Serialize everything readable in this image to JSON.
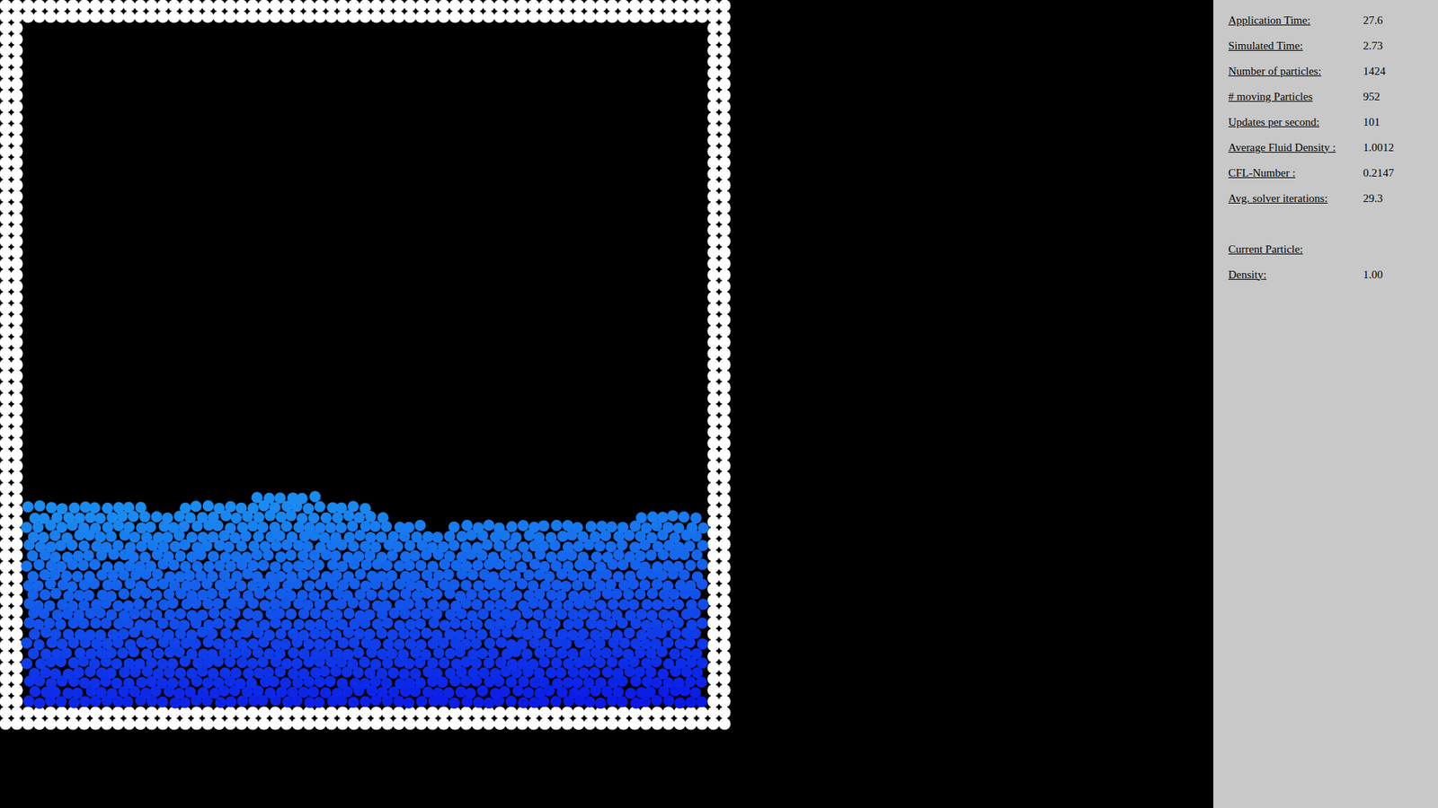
{
  "stats": [
    {
      "label": "Application Time:",
      "value": "27.6"
    },
    {
      "label": "Simulated Time:",
      "value": "2.73"
    },
    {
      "label": "Number of particles:",
      "value": "1424"
    },
    {
      "label": "# moving Particles",
      "value": "952"
    },
    {
      "label": "Updates per second:",
      "value": "101"
    },
    {
      "label": "Average Fluid Density :",
      "value": "1.0012"
    },
    {
      "label": "CFL-Number :",
      "value": "0.2147"
    },
    {
      "label": "Avg. solver iterations:",
      "value": "29.3"
    }
  ],
  "current_particle": {
    "heading": "Current Particle:",
    "fields": [
      {
        "label": "Density:",
        "value": "1.00"
      }
    ]
  },
  "fluid": {
    "surface": [
      0.3,
      0.3,
      0.29,
      0.3,
      0.317,
      0.29,
      0.264,
      0.268,
      0.273,
      0.277,
      0.284
    ],
    "color_top": "#1a8cf0",
    "color_bottom": "#0a14e6"
  }
}
